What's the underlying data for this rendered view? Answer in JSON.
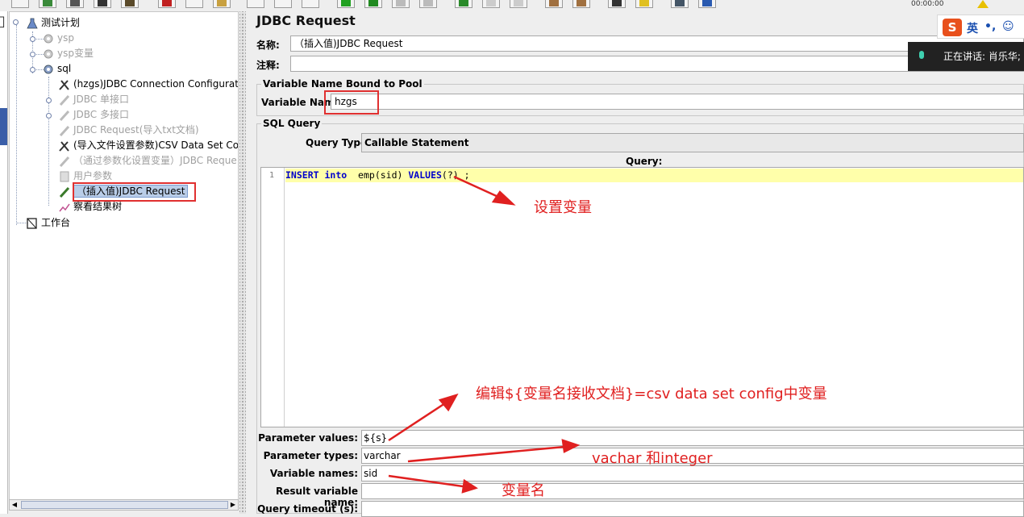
{
  "toolbar": {
    "clock": "00:00:00"
  },
  "tree": {
    "root": "测试计划",
    "items": [
      {
        "label": "ysp",
        "disabled": true
      },
      {
        "label": "ysp变量",
        "disabled": true
      },
      {
        "label": "sql",
        "disabled": false
      },
      {
        "label": "(hzgs)JDBC Connection Configuratio",
        "disabled": false
      },
      {
        "label": "JDBC 单接口",
        "disabled": true
      },
      {
        "label": "JDBC 多接口",
        "disabled": true
      },
      {
        "label": "JDBC Request(导入txt文档)",
        "disabled": true
      },
      {
        "label": "(导入文件设置参数)CSV Data Set Cor",
        "disabled": false
      },
      {
        "label": "（通过参数化设置变量）JDBC Reque",
        "disabled": true
      },
      {
        "label": "用户参数",
        "disabled": true
      },
      {
        "label": "（插入值)JDBC Request",
        "disabled": false,
        "selected": true
      },
      {
        "label": "察看结果树",
        "disabled": false
      }
    ],
    "workbench": "工作台"
  },
  "panel": {
    "title": "JDBC Request",
    "name_label": "名称:",
    "name_value": "（插入值)JDBC Request",
    "comment_label": "注释:",
    "pool_legend": "Variable Name Bound to Pool",
    "variable_name_label": "Variable Name:",
    "variable_name_value": "hzgs",
    "sql_legend": "SQL Query",
    "query_type_label": "Query Type:",
    "query_type_value": "Callable Statement",
    "query_header": "Query:",
    "line_number": "1",
    "query_code": {
      "kw1": "INSERT",
      "kw2": "into",
      "table": "emp(sid)",
      "kw3": "VALUES",
      "params": "(?) ;"
    },
    "param_values_label": "Parameter values:",
    "param_values": "${s}",
    "param_types_label": "Parameter types:",
    "param_types": "varchar",
    "variable_names_label": "Variable names:",
    "variable_names": "sid",
    "result_var_label": "Result variable name:",
    "result_var": "",
    "timeout_label": "Query timeout (s):"
  },
  "annotations": {
    "set_variable": "设置变量",
    "edit_note": "编辑${变量名接收文档}=csv  data  set  config中变量",
    "types_note": "vachar 和integer",
    "var_name_note": "变量名"
  },
  "ime": {
    "logo": "S",
    "lang": "英",
    "punct": "•,",
    "emoji": "☺"
  },
  "voice": {
    "text": "正在讲话: 肖乐华;"
  },
  "colors": {
    "annotation": "#e02020",
    "highlight_line": "#ffffaa",
    "selection": "#b9cde8"
  }
}
